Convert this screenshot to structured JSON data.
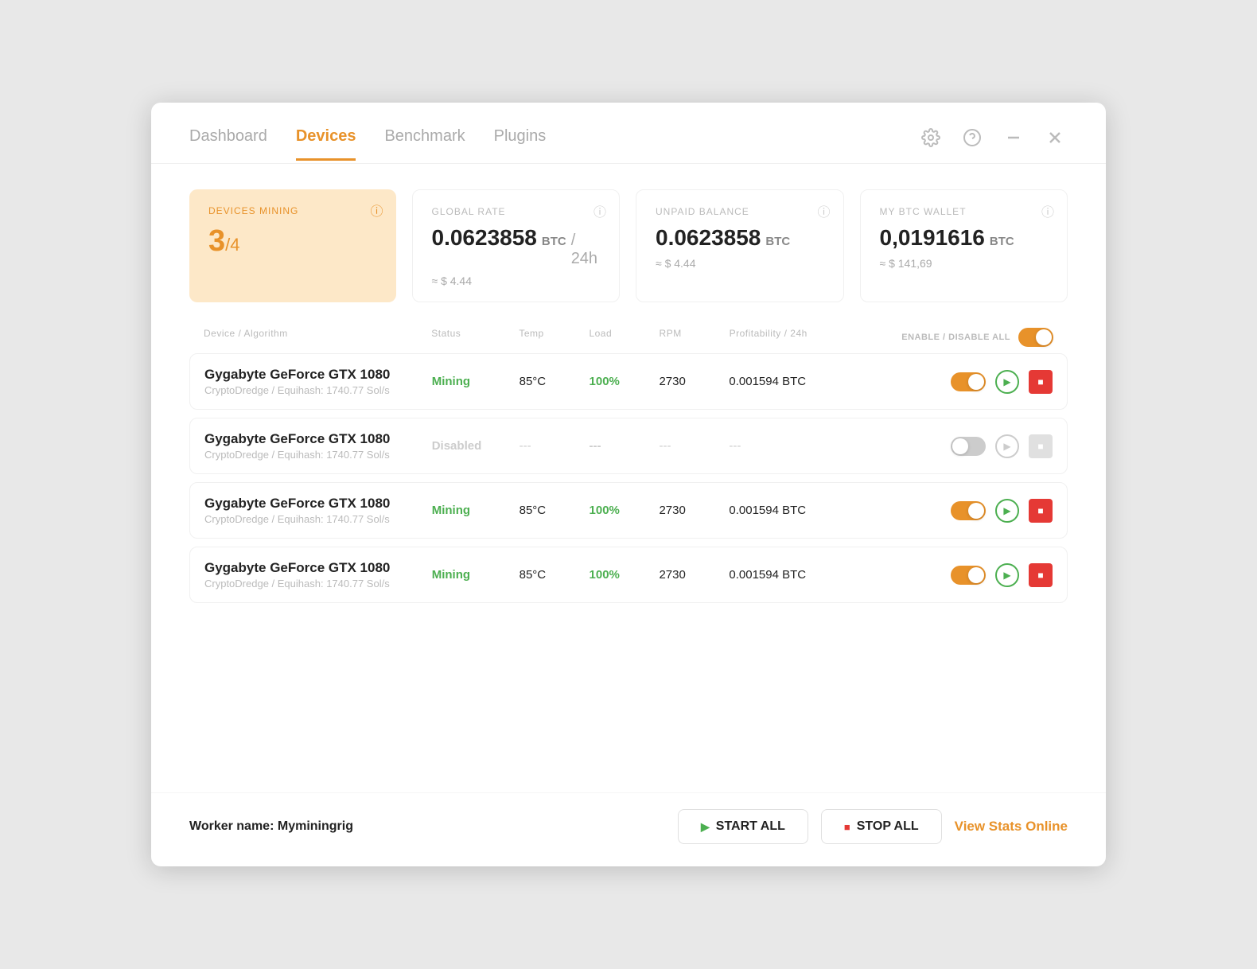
{
  "nav": {
    "tabs": [
      {
        "label": "Dashboard",
        "active": false
      },
      {
        "label": "Devices",
        "active": true
      },
      {
        "label": "Benchmark",
        "active": false
      },
      {
        "label": "Plugins",
        "active": false
      }
    ],
    "icons": [
      "gear",
      "help",
      "minimize",
      "close"
    ]
  },
  "stats": {
    "devices_mining": {
      "label": "DEVICES MINING",
      "count": "3",
      "denom": "/4"
    },
    "global_rate": {
      "label": "GLOBAL RATE",
      "value": "0.0623858",
      "unit": "BTC",
      "per": "/ 24h",
      "sub": "≈ $ 4.44"
    },
    "unpaid_balance": {
      "label": "UNPAID BALANCE",
      "value": "0.0623858",
      "unit": "BTC",
      "sub": "≈ $ 4.44"
    },
    "btc_wallet": {
      "label": "MY BTC WALLET",
      "value": "0,0191616",
      "unit": "BTC",
      "sub": "≈ $ 141,69"
    }
  },
  "table": {
    "headers": [
      "Device / Algorithm",
      "Status",
      "Temp",
      "Load",
      "RPM",
      "Profitability / 24h",
      "ENABLE / DISABLE ALL"
    ],
    "rows": [
      {
        "name": "Gygabyte GeForce GTX 1080",
        "algo": "CryptoDredge / Equihash: 1740.77 Sol/s",
        "status": "Mining",
        "status_type": "mining",
        "temp": "85°C",
        "load": "100%",
        "rpm": "2730",
        "profit": "0.001594 BTC",
        "enabled": true
      },
      {
        "name": "Gygabyte GeForce GTX 1080",
        "algo": "CryptoDredge / Equihash: 1740.77 Sol/s",
        "status": "Disabled",
        "status_type": "disabled",
        "temp": "---",
        "load": "---",
        "rpm": "---",
        "profit": "---",
        "enabled": false
      },
      {
        "name": "Gygabyte GeForce GTX 1080",
        "algo": "CryptoDredge / Equihash: 1740.77 Sol/s",
        "status": "Mining",
        "status_type": "mining",
        "temp": "85°C",
        "load": "100%",
        "rpm": "2730",
        "profit": "0.001594 BTC",
        "enabled": true
      },
      {
        "name": "Gygabyte GeForce GTX 1080",
        "algo": "CryptoDredge / Equihash: 1740.77 Sol/s",
        "status": "Mining",
        "status_type": "mining",
        "temp": "85°C",
        "load": "100%",
        "rpm": "2730",
        "profit": "0.001594 BTC",
        "enabled": true
      }
    ]
  },
  "footer": {
    "worker_prefix": "Worker name:",
    "worker_name": "Myminingrig",
    "start_all": "START ALL",
    "stop_all": "STOP ALL",
    "view_stats": "View Stats Online"
  },
  "colors": {
    "accent": "#e8922a",
    "green": "#4caf50",
    "red": "#e53935",
    "disabled": "#ccc"
  }
}
